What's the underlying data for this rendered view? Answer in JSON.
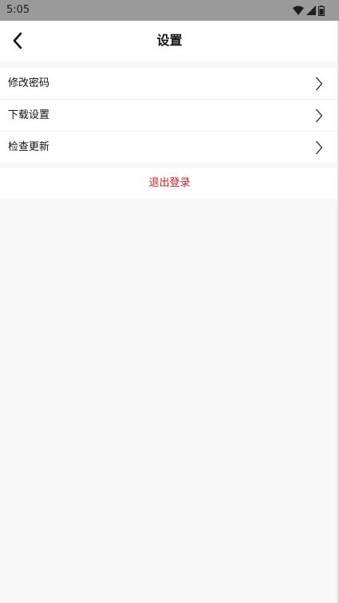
{
  "status_bar": {
    "time": "5:05",
    "icons": [
      "wifi-icon",
      "cell-signal-icon",
      "battery-icon"
    ]
  },
  "header": {
    "title": "设置",
    "back_icon": "chevron-left-icon"
  },
  "settings": {
    "items": [
      {
        "label": "修改密码",
        "icon": "chevron-right-icon"
      },
      {
        "label": "下载设置",
        "icon": "chevron-right-icon"
      },
      {
        "label": "检查更新",
        "icon": "chevron-right-icon"
      }
    ]
  },
  "logout": {
    "label": "退出登录",
    "color": "#d71a1a"
  },
  "colors": {
    "status_bar": "#9a9a9a",
    "background": "#f8f8f8",
    "surface": "#ffffff"
  }
}
